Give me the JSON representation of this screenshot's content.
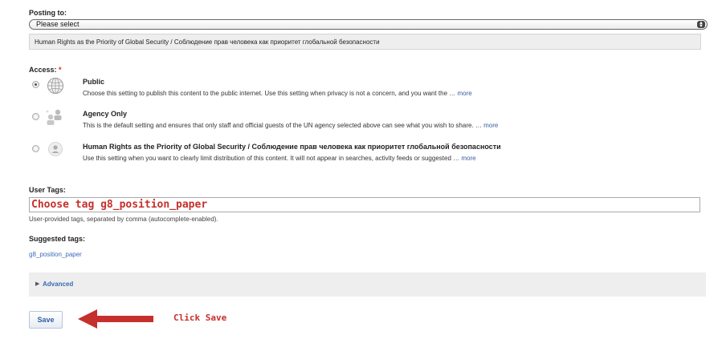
{
  "posting": {
    "label": "Posting to:",
    "select_value": "Please select",
    "group_name": "Human Rights as the Priority of Global Security / Соблюдение прав человека как приоритет глобальной безопасности"
  },
  "access": {
    "label": "Access:",
    "required_mark": "*",
    "options": [
      {
        "title": "Public",
        "desc": "Choose this setting to publish this content to the public internet. Use this setting when privacy is not a concern, and you want the …",
        "more": "more",
        "icon": "globe-icon",
        "selected": true
      },
      {
        "title": "Agency Only",
        "desc": "This is the default setting and ensures that only staff and official guests of the UN agency selected above can see what you wish to share. …",
        "more": "more",
        "icon": "people-icon",
        "selected": false
      },
      {
        "title": "Human Rights as the Priority of Global Security / Соблюдение прав человека как приоритет глобальной безопасности",
        "desc": "Use this setting when you want to clearly limit distribution of this content. It will not appear in searches, activity feeds or suggested …",
        "more": "more",
        "icon": "person-icon",
        "selected": false
      }
    ]
  },
  "tags": {
    "label": "User Tags:",
    "input_value": "Choose tag g8_position_paper",
    "hint": "User-provided tags, separated by comma (autocomplete-enabled).",
    "suggested_label": "Suggested tags:",
    "suggested": [
      "g8_position_paper"
    ]
  },
  "advanced": {
    "label": "Advanced"
  },
  "actions": {
    "save_label": "Save",
    "annotation": "Click Save"
  },
  "colors": {
    "annotation_red": "#c5302c",
    "link_blue": "#3a6ab8"
  }
}
